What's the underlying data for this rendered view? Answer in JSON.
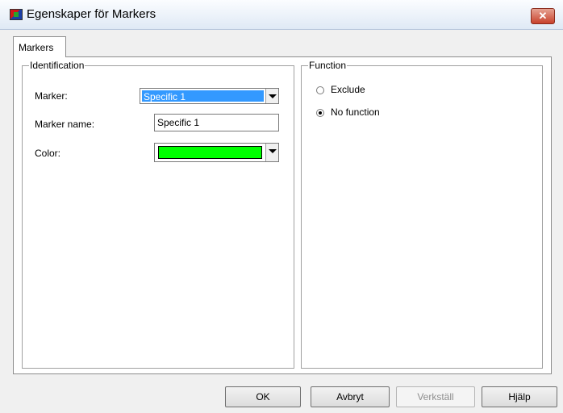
{
  "window": {
    "title": "Egenskaper för Markers",
    "close_glyph": "✕"
  },
  "tabs": [
    {
      "label": "Markers"
    }
  ],
  "identification": {
    "title": "Identification",
    "marker_label": "Marker:",
    "marker_value": "Specific 1",
    "marker_name_label": "Marker name:",
    "marker_name_value": "Specific 1",
    "color_label": "Color:",
    "color_value": "#00ff00"
  },
  "function": {
    "title": "Function",
    "options": [
      {
        "label": "Exclude",
        "checked": false
      },
      {
        "label": "No function",
        "checked": true
      }
    ]
  },
  "buttons": {
    "ok": "OK",
    "cancel": "Avbryt",
    "apply": "Verkställ",
    "help": "Hjälp"
  },
  "icons": {
    "app": "markers-app-icon",
    "close": "close-icon",
    "dropdown": "chevron-down-icon"
  }
}
